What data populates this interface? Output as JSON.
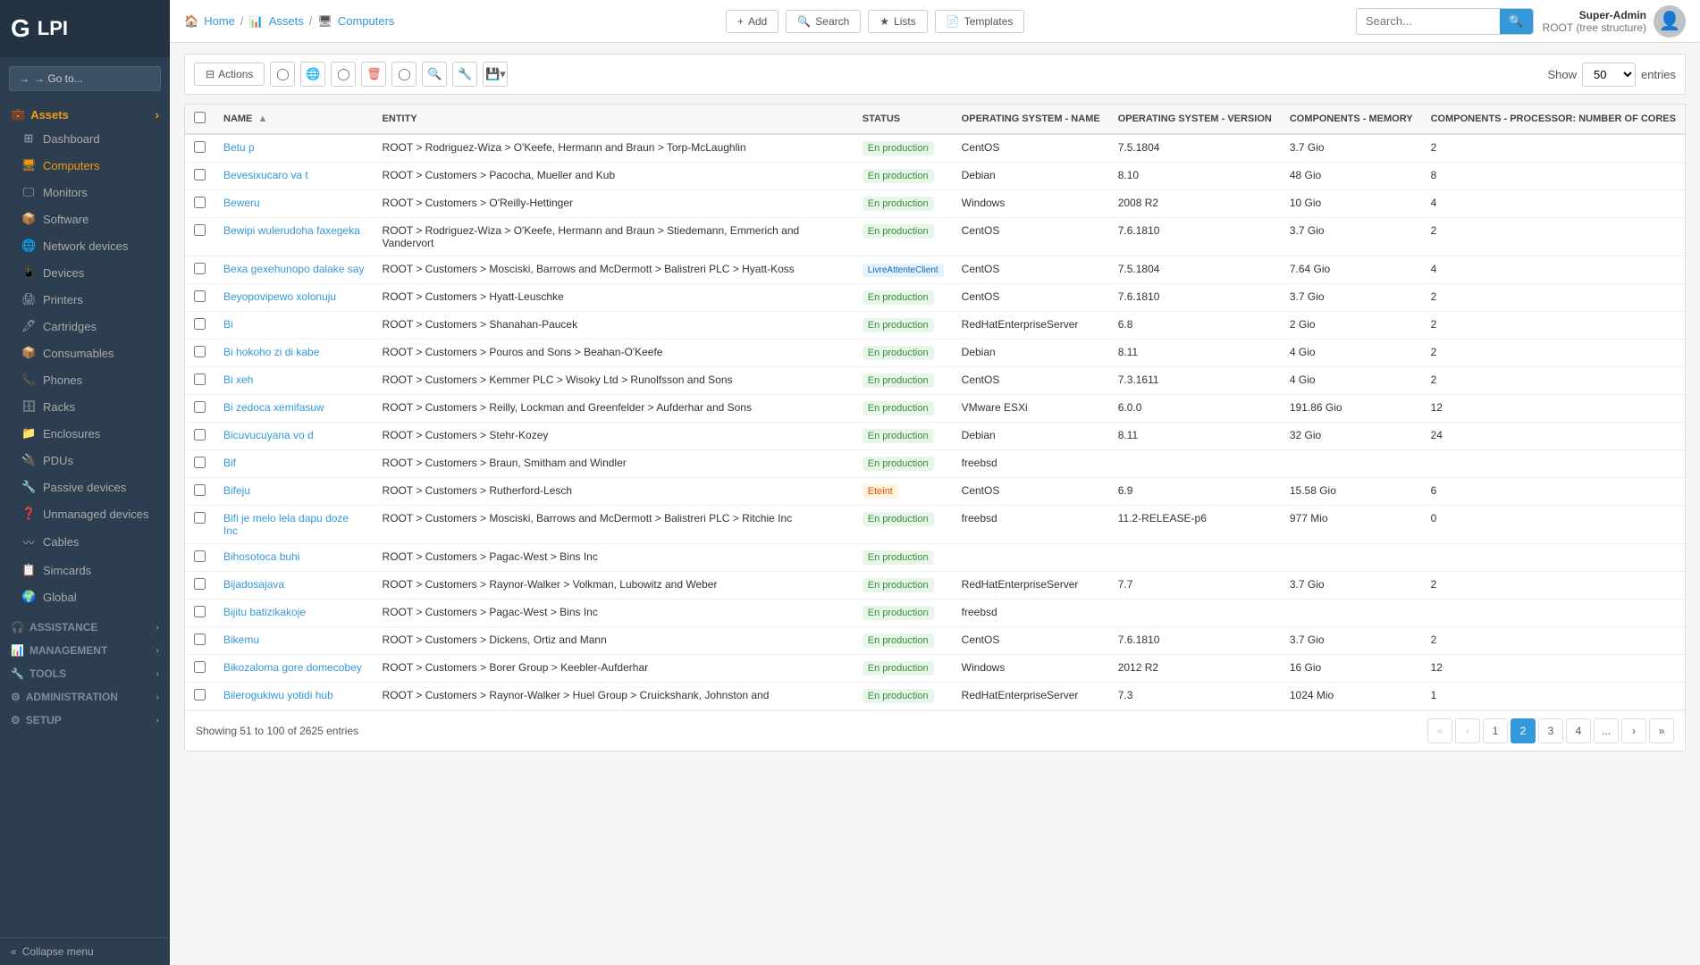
{
  "sidebar": {
    "logo": "GLPI",
    "goto_label": "→ Go to...",
    "sections": [
      {
        "id": "assets",
        "label": "Assets",
        "icon": "💼",
        "items": [
          {
            "id": "dashboard",
            "label": "Dashboard",
            "icon": "⊞"
          },
          {
            "id": "computers",
            "label": "Computers",
            "icon": "🖥",
            "active": true
          },
          {
            "id": "monitors",
            "label": "Monitors",
            "icon": "🖵"
          },
          {
            "id": "software",
            "label": "Software",
            "icon": "📦"
          },
          {
            "id": "network-devices",
            "label": "Network devices",
            "icon": "🌐"
          },
          {
            "id": "devices",
            "label": "Devices",
            "icon": "📱"
          },
          {
            "id": "printers",
            "label": "Printers",
            "icon": "🖨"
          },
          {
            "id": "cartridges",
            "label": "Cartridges",
            "icon": "🖊"
          },
          {
            "id": "consumables",
            "label": "Consumables",
            "icon": "📦"
          },
          {
            "id": "phones",
            "label": "Phones",
            "icon": "📞"
          },
          {
            "id": "racks",
            "label": "Racks",
            "icon": "🗄"
          },
          {
            "id": "enclosures",
            "label": "Enclosures",
            "icon": "📁"
          },
          {
            "id": "pdus",
            "label": "PDUs",
            "icon": "🔌"
          },
          {
            "id": "passive-devices",
            "label": "Passive devices",
            "icon": "🔧"
          },
          {
            "id": "unmanaged-devices",
            "label": "Unmanaged devices",
            "icon": "❓"
          },
          {
            "id": "cables",
            "label": "Cables",
            "icon": "〰"
          },
          {
            "id": "simcards",
            "label": "Simcards",
            "icon": "📋"
          },
          {
            "id": "global",
            "label": "Global",
            "icon": "🌍"
          }
        ]
      },
      {
        "id": "assistance",
        "label": "Assistance",
        "icon": "🎧",
        "items": []
      },
      {
        "id": "management",
        "label": "Management",
        "icon": "📊",
        "items": []
      },
      {
        "id": "tools",
        "label": "Tools",
        "icon": "🔧",
        "items": []
      },
      {
        "id": "administration",
        "label": "Administration",
        "icon": "⚙",
        "items": []
      },
      {
        "id": "setup",
        "label": "Setup",
        "icon": "⚙",
        "items": []
      }
    ],
    "collapse_label": "Collapse menu"
  },
  "topbar": {
    "breadcrumb": [
      "Home",
      "Assets",
      "Computers"
    ],
    "actions": [
      {
        "id": "add",
        "label": "Add",
        "icon": "+"
      },
      {
        "id": "search",
        "label": "Search",
        "icon": "🔍"
      },
      {
        "id": "lists",
        "label": "Lists",
        "icon": "★"
      },
      {
        "id": "templates",
        "label": "Templates",
        "icon": "📄"
      }
    ],
    "search_placeholder": "Search...",
    "user": {
      "name": "Super-Admin",
      "role": "ROOT (tree structure)"
    }
  },
  "toolbar": {
    "actions_label": "Actions",
    "show_label": "Show",
    "entries_label": "entries",
    "show_value": "50"
  },
  "table": {
    "columns": [
      {
        "id": "name",
        "label": "NAME",
        "sortable": true
      },
      {
        "id": "entity",
        "label": "ENTITY"
      },
      {
        "id": "status",
        "label": "STATUS"
      },
      {
        "id": "os_name",
        "label": "OPERATING SYSTEM - NAME"
      },
      {
        "id": "os_version",
        "label": "OPERATING SYSTEM - VERSION"
      },
      {
        "id": "components_memory",
        "label": "COMPONENTS - MEMORY"
      },
      {
        "id": "components_cores",
        "label": "COMPONENTS - PROCESSOR: NUMBER OF CORES"
      }
    ],
    "rows": [
      {
        "name": "Betu p",
        "entity": "ROOT > Rodriguez-Wiza > O'Keefe, Hermann and Braun > Torp-McLaughlin",
        "status": "En production",
        "os_name": "CentOS",
        "os_version": "7.5.1804",
        "memory": "3.7 Gio",
        "cores": "2"
      },
      {
        "name": "Bevesixucaro va t",
        "entity": "ROOT > Customers > Pacocha, Mueller and Kub",
        "status": "En production",
        "os_name": "Debian",
        "os_version": "8.10",
        "memory": "48 Gio",
        "cores": "8"
      },
      {
        "name": "Beweru",
        "entity": "ROOT > Customers > O'Reilly-Hettinger",
        "status": "En production",
        "os_name": "Windows",
        "os_version": "2008 R2",
        "memory": "10 Gio",
        "cores": "4"
      },
      {
        "name": "Bewipi wulerudoha faxegeka",
        "entity": "ROOT > Rodriguez-Wiza > O'Keefe, Hermann and Braun > Stiedemann, Emmerich and Vandervort",
        "status": "En production",
        "os_name": "CentOS",
        "os_version": "7.6.1810",
        "memory": "3.7 Gio",
        "cores": "2"
      },
      {
        "name": "Bexa gexehunopo dalake say",
        "entity": "ROOT > Customers > Mosciski, Barrows and McDermott > Balistreri PLC > Hyatt-Koss",
        "status": "LivreAttenteClient",
        "os_name": "CentOS",
        "os_version": "7.5.1804",
        "memory": "7.64 Gio",
        "cores": "4"
      },
      {
        "name": "Beyopovipewo xolonuju",
        "entity": "ROOT > Customers > Hyatt-Leuschke",
        "status": "En production",
        "os_name": "CentOS",
        "os_version": "7.6.1810",
        "memory": "3.7 Gio",
        "cores": "2"
      },
      {
        "name": "Bi",
        "entity": "ROOT > Customers > Shanahan-Paucek",
        "status": "En production",
        "os_name": "RedHatEnterpriseServer",
        "os_version": "6.8",
        "memory": "2 Gio",
        "cores": "2"
      },
      {
        "name": "Bi hokoho zi di kabe",
        "entity": "ROOT > Customers > Pouros and Sons > Beahan-O'Keefe",
        "status": "En production",
        "os_name": "Debian",
        "os_version": "8.11",
        "memory": "4 Gio",
        "cores": "2"
      },
      {
        "name": "Bi xeh",
        "entity": "ROOT > Customers > Kemmer PLC > Wisoky Ltd > Runolfsson and Sons",
        "status": "En production",
        "os_name": "CentOS",
        "os_version": "7.3.1611",
        "memory": "4 Gio",
        "cores": "2"
      },
      {
        "name": "Bi zedoca xemifasuw",
        "entity": "ROOT > Customers > Reilly, Lockman and Greenfelder > Aufderhar and Sons",
        "status": "En production",
        "os_name": "VMware ESXi",
        "os_version": "6.0.0",
        "memory": "191.86 Gio",
        "cores": "12"
      },
      {
        "name": "Bicuvucuyana vo d",
        "entity": "ROOT > Customers > Stehr-Kozey",
        "status": "En production",
        "os_name": "Debian",
        "os_version": "8.11",
        "memory": "32 Gio",
        "cores": "24"
      },
      {
        "name": "Bif",
        "entity": "ROOT > Customers > Braun, Smitham and Windler",
        "status": "En production",
        "os_name": "freebsd",
        "os_version": "",
        "memory": "",
        "cores": ""
      },
      {
        "name": "Bifeju",
        "entity": "ROOT > Customers > Rutherford-Lesch",
        "status": "Eteint",
        "os_name": "CentOS",
        "os_version": "6.9",
        "memory": "15.58 Gio",
        "cores": "6"
      },
      {
        "name": "Bifi je melo lela dapu doze Inc",
        "entity": "ROOT > Customers > Mosciski, Barrows and McDermott > Balistreri PLC > Ritchie Inc",
        "status": "En production",
        "os_name": "freebsd",
        "os_version": "11.2-RELEASE-p6",
        "memory": "977 Mio",
        "cores": "0"
      },
      {
        "name": "Bihosotoca buhi",
        "entity": "ROOT > Customers > Pagac-West > Bins Inc",
        "status": "En production",
        "os_name": "",
        "os_version": "",
        "memory": "",
        "cores": ""
      },
      {
        "name": "Bijadosajava",
        "entity": "ROOT > Customers > Raynor-Walker > Volkman, Lubowitz and Weber",
        "status": "En production",
        "os_name": "RedHatEnterpriseServer",
        "os_version": "7.7",
        "memory": "3.7 Gio",
        "cores": "2"
      },
      {
        "name": "Bijitu batizikakoje",
        "entity": "ROOT > Customers > Pagac-West > Bins Inc",
        "status": "En production",
        "os_name": "freebsd",
        "os_version": "",
        "memory": "",
        "cores": ""
      },
      {
        "name": "Bikemu",
        "entity": "ROOT > Customers > Dickens, Ortiz and Mann",
        "status": "En production",
        "os_name": "CentOS",
        "os_version": "7.6.1810",
        "memory": "3.7 Gio",
        "cores": "2"
      },
      {
        "name": "Bikozaloma gore domecobey",
        "entity": "ROOT > Customers > Borer Group > Keebler-Aufderhar",
        "status": "En production",
        "os_name": "Windows",
        "os_version": "2012 R2",
        "memory": "16 Gio",
        "cores": "12"
      },
      {
        "name": "Bilerogukiwu yotidi hub",
        "entity": "ROOT > Customers > Raynor-Walker > Huel Group > Cruickshank, Johnston and",
        "status": "En production",
        "os_name": "RedHatEnterpriseServer",
        "os_version": "7.3",
        "memory": "1024 Mio",
        "cores": "1"
      }
    ]
  },
  "pagination": {
    "summary": "Showing 51 to 100 of 2625 entries",
    "pages": [
      "1",
      "2",
      "3",
      "4",
      "..."
    ],
    "current_page": "2"
  }
}
